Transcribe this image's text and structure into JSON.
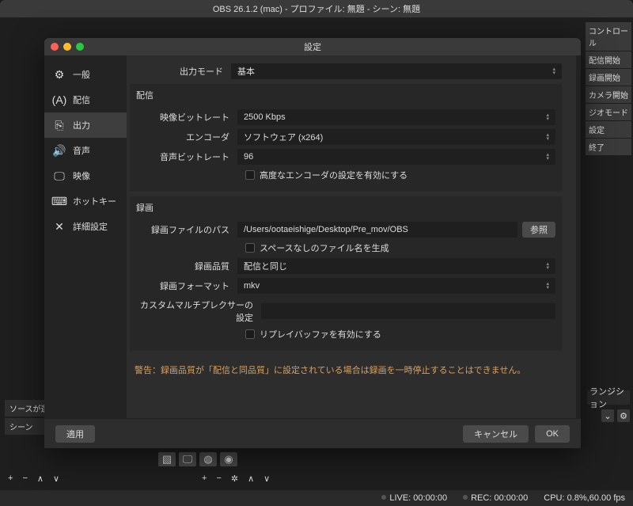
{
  "window": {
    "title": "OBS 26.1.2 (mac) - プロファイル: 無題 - シーン: 無題"
  },
  "modal": {
    "title": "設定",
    "sidebar": [
      {
        "label": "一般"
      },
      {
        "label": "配信"
      },
      {
        "label": "出力"
      },
      {
        "label": "音声"
      },
      {
        "label": "映像"
      },
      {
        "label": "ホットキー"
      },
      {
        "label": "詳細設定"
      }
    ],
    "output_mode": {
      "label": "出力モード",
      "value": "基本"
    },
    "stream": {
      "header": "配信",
      "video_bitrate": {
        "label": "映像ビットレート",
        "value": "2500 Kbps"
      },
      "encoder": {
        "label": "エンコーダ",
        "value": "ソフトウェア (x264)"
      },
      "audio_bitrate": {
        "label": "音声ビットレート",
        "value": "96"
      },
      "adv_enc_chk": "高度なエンコーダの設定を有効にする"
    },
    "record": {
      "header": "録画",
      "path": {
        "label": "録画ファイルのパス",
        "value": "/Users/ootaeishige/Desktop/Pre_mov/OBS",
        "browse": "参照"
      },
      "nospace_chk": "スペースなしのファイル名を生成",
      "quality": {
        "label": "録画品質",
        "value": "配信と同じ"
      },
      "format": {
        "label": "録画フォーマット",
        "value": "mkv"
      },
      "mux": {
        "label": "カスタムマルチプレクサーの設定",
        "value": ""
      },
      "replay_chk": "リプレイバッファを有効にする"
    },
    "warning": "警告：録画品質が「配信と同品質」に設定されている場合は録画を一時停止することはできません。",
    "buttons": {
      "apply": "適用",
      "cancel": "キャンセル",
      "ok": "OK"
    }
  },
  "right_strip": [
    "コントロール",
    "配信開始",
    "録画開始",
    "カメラ開始",
    "ジオモード",
    "設定",
    "終了"
  ],
  "left_panel": {
    "sources": "ソースが選",
    "scene": "シーン"
  },
  "transition": "ランジション",
  "status": {
    "live": "LIVE: 00:00:00",
    "rec": "REC: 00:00:00",
    "cpu": "CPU: 0.8%,60.00 fps"
  }
}
